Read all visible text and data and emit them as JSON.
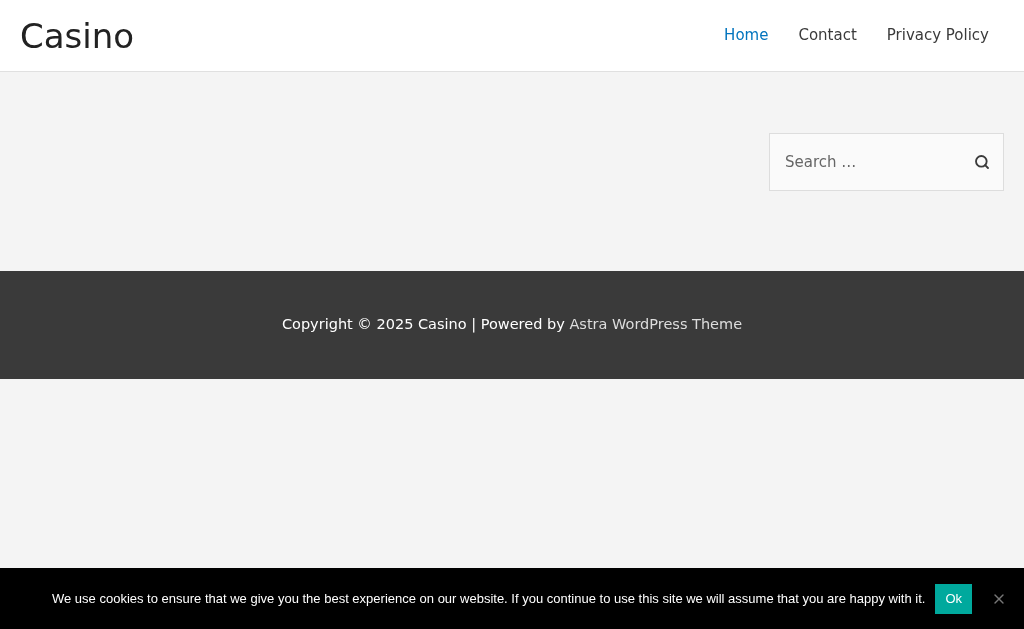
{
  "site_title": "Casino",
  "nav": [
    {
      "label": "Home",
      "selected": true
    },
    {
      "label": "Contact",
      "selected": false
    },
    {
      "label": "Privacy Policy",
      "selected": false
    }
  ],
  "search": {
    "placeholder": "Search …"
  },
  "footer": {
    "text": "Copyright © 2025 Casino | Powered by ",
    "link": "Astra WordPress Theme"
  },
  "cookie_notice": {
    "text": "We use cookies to ensure that we give you the best experience on our website. If you continue to use this site we will assume that you are happy with it.",
    "accept_button": "Ok"
  }
}
